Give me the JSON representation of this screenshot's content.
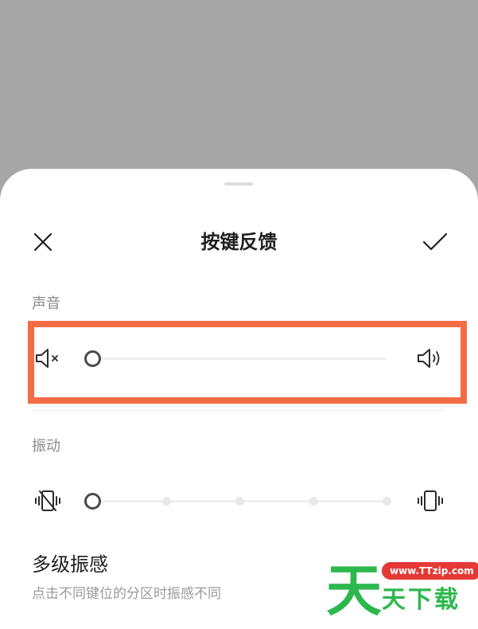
{
  "sheet": {
    "title": "按键反馈",
    "close_icon": "close-icon",
    "confirm_icon": "checkmark-icon"
  },
  "sound": {
    "label": "声音",
    "min_icon": "volume-mute-icon",
    "max_icon": "volume-up-icon",
    "level": 0,
    "highlight_color": "#f46c45"
  },
  "vibration": {
    "label": "振动",
    "min_icon": "vibration-off-icon",
    "max_icon": "vibration-icon",
    "level": 0,
    "steps": 5
  },
  "multi_vibration": {
    "title": "多级振感",
    "description": "点击不同键位的分区时振感不同"
  },
  "watermark": {
    "url": "www.TTzip.com",
    "big_char": "天",
    "small_text": "天下载"
  }
}
